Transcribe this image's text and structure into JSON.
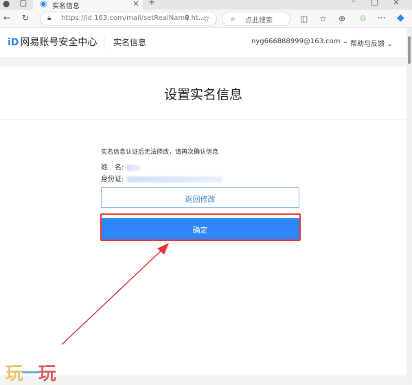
{
  "browser": {
    "tab_title": "实名信息",
    "url_host": "https://id.163.com",
    "url_path": "/mail/setRealName.ht...",
    "search_placeholder": "点此搜索"
  },
  "header": {
    "logo_text": "网易账号安全中心",
    "logo_mark": "iD",
    "section": "实名信息",
    "account": "nyg666888999@163.com",
    "help": "帮助与反馈"
  },
  "main": {
    "title": "设置实名信息",
    "notice": "实名信息认证后无法修改，请再次确认信息",
    "name_label": "姓　名:",
    "id_label": "身份证:",
    "back_button": "返回修改",
    "confirm_button": "确定"
  },
  "watermark": "玩一玩",
  "colors": {
    "accent": "#2f86f6",
    "highlight": "#e53935"
  }
}
